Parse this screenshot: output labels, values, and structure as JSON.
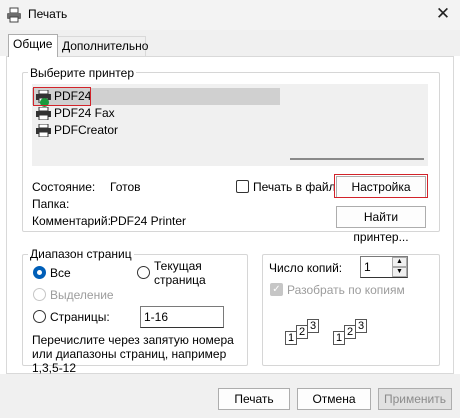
{
  "window": {
    "title": "Печать",
    "close_icon": "close-icon"
  },
  "tabs": [
    "Общие",
    "Дополнительно"
  ],
  "printer_group": {
    "label": "Выберите принтер",
    "printers": [
      "PDF24",
      "PDF24 Fax",
      "PDFCreator"
    ],
    "status_label": "Состояние:",
    "status_value": "Готов",
    "folder_label": "Папка:",
    "comment_label": "Комментарий:",
    "comment_value": "PDF24 Printer",
    "print_to_file": "Печать в файл",
    "settings_button": "Настройка",
    "find_printer_button": "Найти принтер..."
  },
  "range_group": {
    "label": "Диапазон страниц",
    "all": "Все",
    "current_page": "Текущая страница",
    "selection": "Выделение",
    "pages": "Страницы:",
    "pages_value": "1-16",
    "hint": "Перечислите через запятую номера или диапазоны страниц, например 1,3,5-12"
  },
  "copies_group": {
    "copies_label": "Число копий:",
    "copies_value": "1",
    "collate": "Разобрать по копиям",
    "page_numbers": [
      "1",
      "2",
      "3"
    ]
  },
  "footer": {
    "print": "Печать",
    "cancel": "Отмена",
    "apply": "Применить"
  }
}
